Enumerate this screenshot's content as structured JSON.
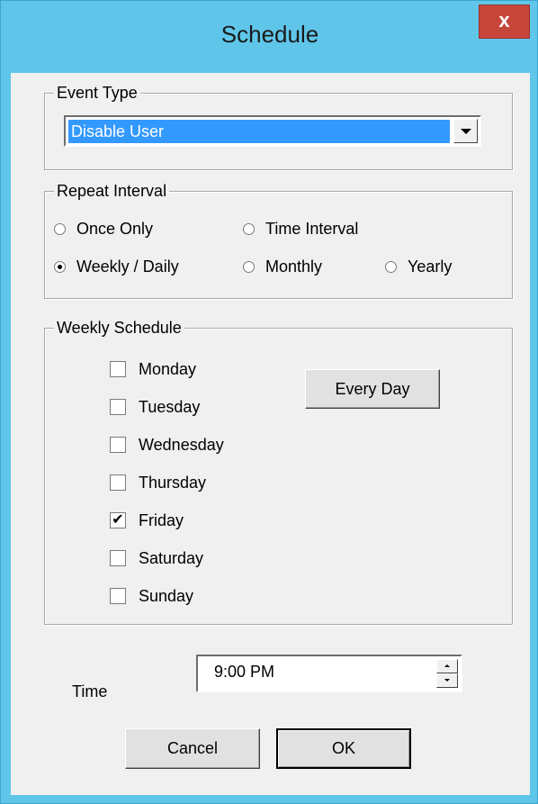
{
  "window": {
    "title": "Schedule",
    "close_glyph": "x"
  },
  "event_type": {
    "legend": "Event Type",
    "selected": "Disable User"
  },
  "repeat_interval": {
    "legend": "Repeat Interval",
    "options": [
      {
        "label": "Once Only",
        "checked": false
      },
      {
        "label": "Time Interval",
        "checked": false
      },
      {
        "label": "Weekly / Daily",
        "checked": true
      },
      {
        "label": "Monthly",
        "checked": false
      },
      {
        "label": "Yearly",
        "checked": false
      }
    ]
  },
  "weekly_schedule": {
    "legend": "Weekly Schedule",
    "days": [
      {
        "label": "Monday",
        "checked": false
      },
      {
        "label": "Tuesday",
        "checked": false
      },
      {
        "label": "Wednesday",
        "checked": false
      },
      {
        "label": "Thursday",
        "checked": false
      },
      {
        "label": "Friday",
        "checked": true
      },
      {
        "label": "Saturday",
        "checked": false
      },
      {
        "label": "Sunday",
        "checked": false
      }
    ],
    "every_day_label": "Every Day"
  },
  "time": {
    "label": "Time",
    "value": "9:00 PM"
  },
  "buttons": {
    "cancel": "Cancel",
    "ok": "OK"
  },
  "colors": {
    "title_bar": "#5fc6ea",
    "close_button": "#c7463b",
    "selection": "#3399ff",
    "dialog_face": "#f0f0f0"
  }
}
